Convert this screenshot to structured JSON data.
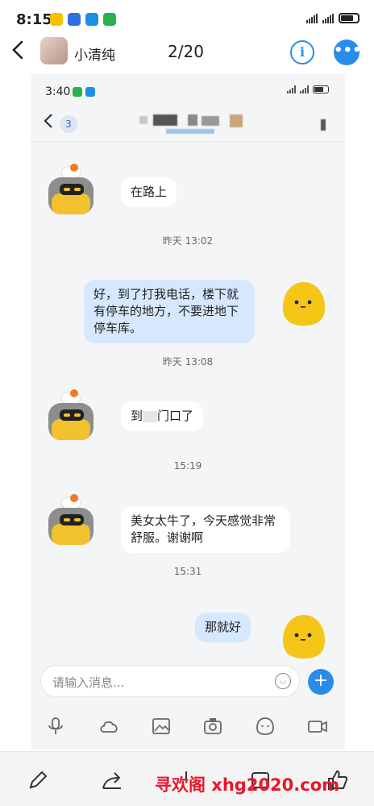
{
  "status_bar": {
    "time": "8:15",
    "app_icons": [
      "meituan-icon",
      "map-icon",
      "app-icon",
      "wechat-icon"
    ],
    "signal_icons": [
      "signal-icon",
      "signal-icon"
    ],
    "battery_icon": "battery-icon"
  },
  "header": {
    "back_icon": "chevron-left-icon",
    "name": "小清纯",
    "page_count": "2/20",
    "info_label": "i",
    "more_label": "•••"
  },
  "inner": {
    "status_time": "3:40",
    "header_badge": "3",
    "messages": [
      {
        "side": "in",
        "text": "在路上"
      },
      {
        "timestamp": "昨天 13:02"
      },
      {
        "side": "out",
        "text": "好，到了打我电话，楼下就有停车的地方，不要进地下停车库。"
      },
      {
        "timestamp": "昨天 13:08"
      },
      {
        "side": "in",
        "text_a": "到",
        "text_b": "门口了"
      },
      {
        "timestamp": "15:19"
      },
      {
        "side": "in",
        "text": "美女太牛了，今天感觉非常舒服。谢谢啊"
      },
      {
        "timestamp": "15:31"
      },
      {
        "side": "out",
        "text": "那就好"
      }
    ],
    "input_placeholder": "请输入消息...",
    "send_label": "+",
    "toolbar": [
      "mic-icon",
      "cloud-icon",
      "image-icon",
      "camera-icon",
      "emoji-icon",
      "video-call-icon"
    ]
  },
  "bottom_bar": {
    "icons": [
      "edit-icon",
      "share-icon",
      "save-icon",
      "copy-icon",
      "like-icon"
    ]
  },
  "watermark": "寻欢阁 xhg2020.com",
  "colors": {
    "accent": "#2a8cea",
    "bubble_out": "#d6e8ff",
    "watermark": "#e8172b"
  }
}
